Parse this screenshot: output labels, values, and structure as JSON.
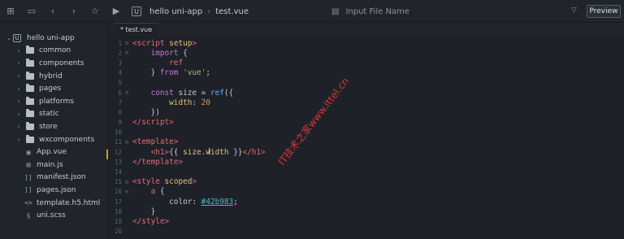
{
  "toolbar": {
    "icons": [
      "new-file-icon",
      "save-icon",
      "back-icon",
      "forward-icon",
      "star-icon",
      "run-icon"
    ],
    "breadcrumb": [
      "hello uni-app",
      "test.vue"
    ],
    "file_input_placeholder": "Input File Name",
    "preview_label": "Preview"
  },
  "sidebar": {
    "root": "hello uni-app",
    "folders": [
      "common",
      "components",
      "hybrid",
      "pages",
      "platforms",
      "static",
      "store",
      "wxcomponents"
    ],
    "files": [
      {
        "name": "App.vue",
        "icon": "vue-file-icon"
      },
      {
        "name": "main.js",
        "icon": "js-file-icon"
      },
      {
        "name": "manifest.json",
        "icon": "json-file-icon"
      },
      {
        "name": "pages.json",
        "icon": "json-file-icon"
      },
      {
        "name": "template.h5.html",
        "icon": "html-file-icon"
      },
      {
        "name": "uni.scss",
        "icon": "scss-file-icon"
      }
    ]
  },
  "editor": {
    "tab": "* test.vue",
    "line_numbers": [
      "1",
      "2",
      "3",
      "4",
      "5",
      "6",
      "7",
      "8",
      "9",
      "10",
      "11",
      "12",
      "13",
      "14",
      "15",
      "16",
      "17",
      "18",
      "19",
      "20"
    ],
    "color_value": "#42b983"
  },
  "watermark": "IT技术之家www.ittel.cn"
}
